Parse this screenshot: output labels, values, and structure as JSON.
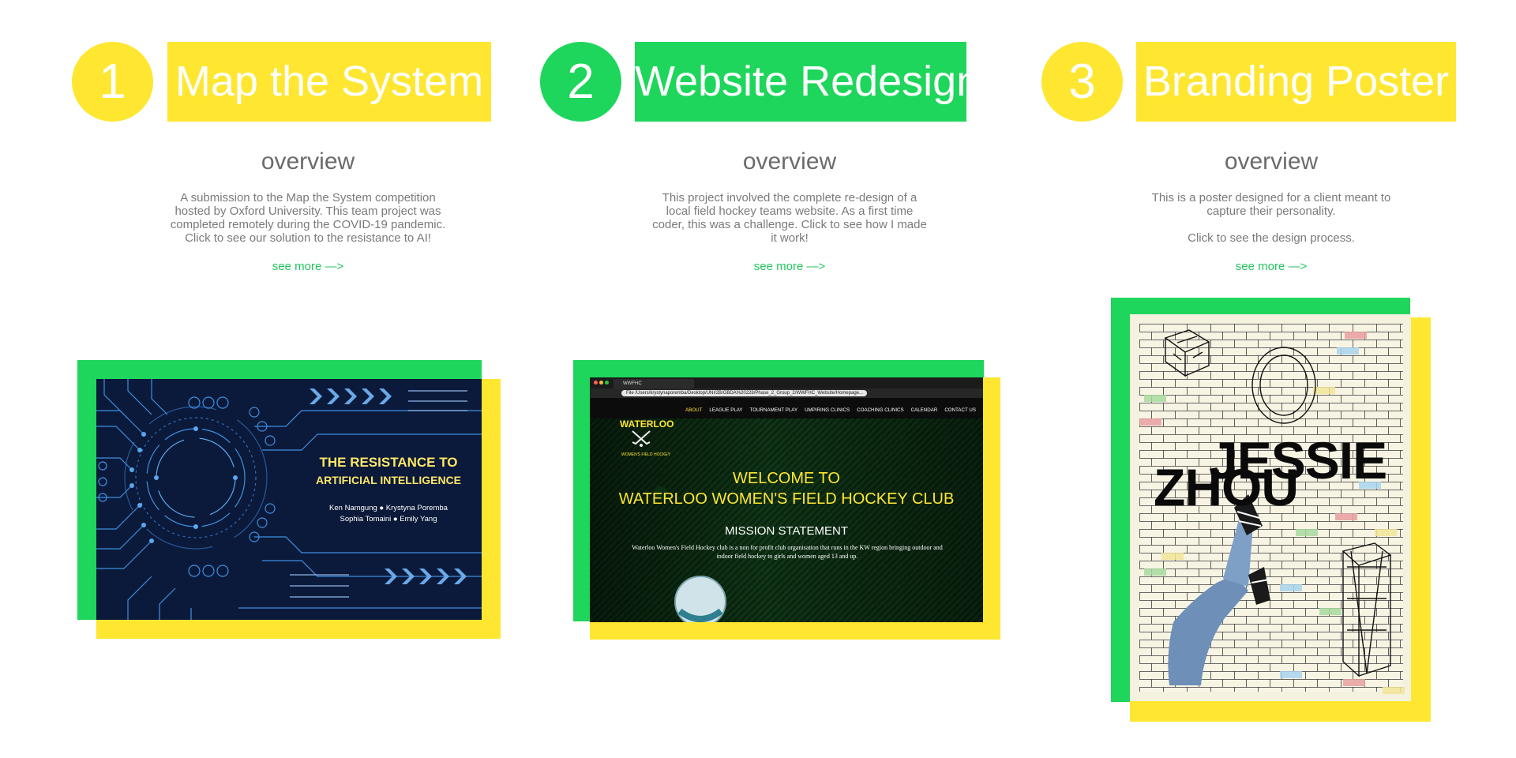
{
  "colors": {
    "yellow": "#ffe631",
    "green": "#1ed65b",
    "text_gray": "#6b6b6b",
    "link_green": "#23c55e"
  },
  "projects": [
    {
      "number": "1",
      "title": "Map the System",
      "overview_heading": "overview",
      "description": "A submission to the Map the System competition hosted by Oxford University. This team project was completed remotely during the COVID-19 pandemic. Click to see our solution to the resistance to AI!",
      "see_more": "see more —>",
      "preview": {
        "title_line1": "THE RESISTANCE TO",
        "title_line2": "ARTIFICIAL INTELLIGENCE",
        "names_line1": "Ken Namgung ● Krystyna Poremba",
        "names_line2": "Sophia Tomaini ● Emily Yang"
      }
    },
    {
      "number": "2",
      "title": "Website Redesign",
      "overview_heading": "overview",
      "description": "This project involved the complete re-design of a local field hockey teams website. As a first time coder, this was a challenge. Click to see how I made it work!",
      "see_more": "see more —>",
      "preview": {
        "tab_title": "WWFHC",
        "url": "File   /Users/krystynaporemba/Desktop/UNI/2B/GBDA%20228/Phase_2_Group_2/WWFHC_Website/Homepage...",
        "nav": [
          "ABOUT",
          "LEAGUE PLAY",
          "TOURNAMENT PLAY",
          "UMPIRING CLINICS",
          "COACHING CLINICS",
          "CALENDAR",
          "CONTACT US"
        ],
        "logo_text": "WATERLOO",
        "logo_sub": "WOMEN'S FIELD HOCKEY",
        "welcome_line1": "WELCOME TO",
        "welcome_line2": "WATERLOO WOMEN'S FIELD HOCKEY CLUB",
        "mission_heading": "MISSION STATEMENT",
        "mission_text": "Waterloo Women's Field Hockey club is a non for profit club organisation that runs in the KW region bringing outdoor and indoor field hockey to girls and women aged 13 and up."
      }
    },
    {
      "number": "3",
      "title": "Branding Poster",
      "overview_heading": "overview",
      "description_line1": "This is a poster designed for a client meant to capture their personality.",
      "description_line2": "Click to see the design process.",
      "see_more": "see more —>",
      "preview": {
        "name_first": "JESSIE",
        "name_last": "ZHOU"
      }
    }
  ]
}
